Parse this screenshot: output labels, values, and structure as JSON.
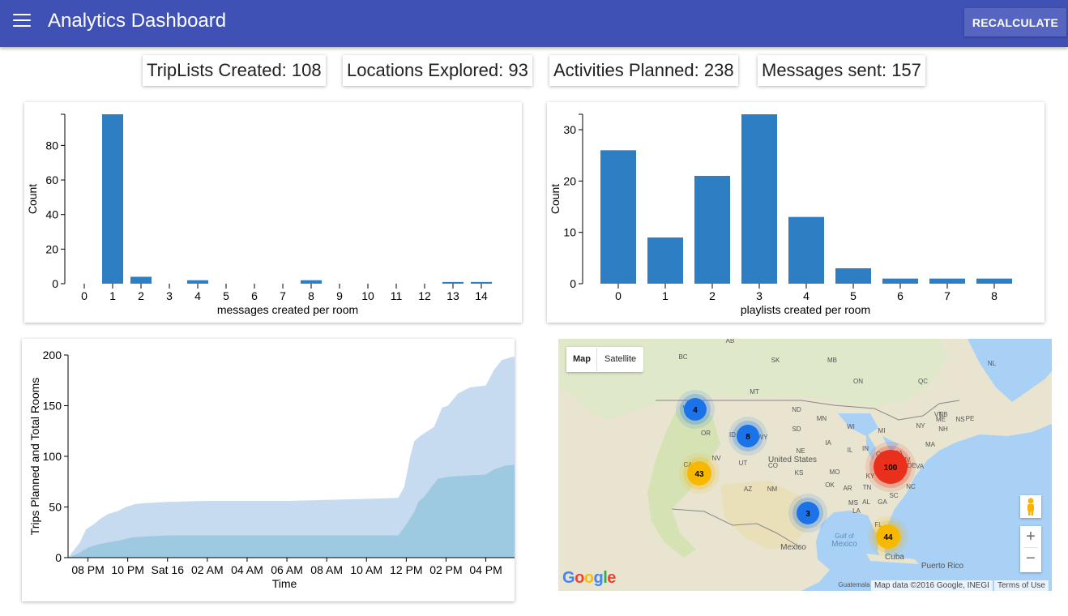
{
  "header": {
    "title": "Analytics Dashboard",
    "recalculate_label": "RECALCULATE",
    "menu_icon": "menu-icon"
  },
  "stats": [
    {
      "label": "TripLists Created: 108"
    },
    {
      "label": "Locations Explored: 93"
    },
    {
      "label": "Activities Planned: 238"
    },
    {
      "label": "Messages sent: 157"
    }
  ],
  "chart_data": [
    {
      "type": "bar",
      "categories": [
        "0",
        "1",
        "2",
        "3",
        "4",
        "5",
        "6",
        "7",
        "8",
        "9",
        "10",
        "11",
        "12",
        "13",
        "14"
      ],
      "values": [
        0,
        98,
        4,
        0,
        2,
        0,
        0,
        0,
        2,
        0,
        0,
        0,
        0,
        1,
        1
      ],
      "xlabel": "messages created per room",
      "ylabel": "Count",
      "ylim": [
        0,
        98
      ],
      "yticks": [
        0,
        20,
        40,
        60,
        80
      ],
      "color": "#2e7ec3"
    },
    {
      "type": "bar",
      "categories": [
        "0",
        "1",
        "2",
        "3",
        "4",
        "5",
        "6",
        "7",
        "8"
      ],
      "values": [
        26,
        9,
        21,
        33,
        13,
        3,
        1,
        1,
        1
      ],
      "xlabel": "playlists created per room",
      "ylabel": "Count",
      "ylim": [
        0,
        33
      ],
      "yticks": [
        0,
        10,
        20,
        30
      ],
      "color": "#2e7ec3"
    },
    {
      "type": "area",
      "xlabel": "Time",
      "ylabel": "Trips Planned and Total Rooms",
      "ylim": [
        0,
        200
      ],
      "yticks": [
        0,
        50,
        100,
        150,
        200
      ],
      "x_tick_labels": [
        "08 PM",
        "10 PM",
        "Sat 16",
        "02 AM",
        "04 AM",
        "06 AM",
        "08 AM",
        "10 AM",
        "12 PM",
        "02 PM",
        "04 PM"
      ],
      "x_hours": [
        0,
        2,
        4,
        6,
        8,
        10,
        12,
        14,
        16,
        18,
        20
      ],
      "series": [
        {
          "color": "#c6dbef",
          "points": [
            [
              -1.0,
              0
            ],
            [
              -0.4,
              15
            ],
            [
              -0.1,
              28
            ],
            [
              0.3,
              33
            ],
            [
              0.6,
              38
            ],
            [
              1.0,
              43
            ],
            [
              1.5,
              46
            ],
            [
              1.9,
              50
            ],
            [
              2.4,
              53
            ],
            [
              3.0,
              54
            ],
            [
              4.0,
              55
            ],
            [
              6.0,
              56
            ],
            [
              8.0,
              56
            ],
            [
              10.0,
              56
            ],
            [
              12.0,
              57
            ],
            [
              14.0,
              58
            ],
            [
              15.6,
              59
            ],
            [
              15.9,
              70
            ],
            [
              16.2,
              100
            ],
            [
              16.4,
              115
            ],
            [
              16.7,
              120
            ],
            [
              17.0,
              124
            ],
            [
              17.4,
              129
            ],
            [
              17.8,
              148
            ],
            [
              18.1,
              150
            ],
            [
              18.6,
              162
            ],
            [
              19.2,
              168
            ],
            [
              20.0,
              170
            ],
            [
              20.4,
              185
            ],
            [
              20.8,
              195
            ],
            [
              21.3,
              198
            ],
            [
              21.6,
              199
            ]
          ]
        },
        {
          "color": "#9ecae1",
          "points": [
            [
              -1.0,
              0
            ],
            [
              -0.4,
              5
            ],
            [
              0.0,
              10
            ],
            [
              0.5,
              13
            ],
            [
              1.0,
              15
            ],
            [
              1.6,
              17
            ],
            [
              2.2,
              20
            ],
            [
              3.0,
              21
            ],
            [
              4.0,
              22
            ],
            [
              6.0,
              22
            ],
            [
              8.0,
              22
            ],
            [
              10.0,
              22
            ],
            [
              12.0,
              22
            ],
            [
              14.0,
              22
            ],
            [
              15.6,
              22
            ],
            [
              15.9,
              30
            ],
            [
              16.4,
              45
            ],
            [
              16.6,
              55
            ],
            [
              16.9,
              60
            ],
            [
              17.2,
              68
            ],
            [
              17.6,
              78
            ],
            [
              18.2,
              80
            ],
            [
              19.0,
              81
            ],
            [
              20.0,
              82
            ],
            [
              20.4,
              87
            ],
            [
              21.0,
              91
            ],
            [
              21.6,
              92
            ]
          ]
        }
      ]
    }
  ],
  "map": {
    "map_label": "Map",
    "satellite_label": "Satellite",
    "google_logo": "Google",
    "attribution": "Map data ©2016 Google, INEGI",
    "terms": "Terms of Use",
    "pegman_icon": "pegman-icon",
    "zoom_in_label": "+",
    "zoom_out_label": "−",
    "place_labels": [
      {
        "text": "AB"
      },
      {
        "text": "BC"
      },
      {
        "text": "SK"
      },
      {
        "text": "MB"
      },
      {
        "text": "QC"
      },
      {
        "text": "NL"
      },
      {
        "text": "ON"
      },
      {
        "text": "WA"
      },
      {
        "text": "MT"
      },
      {
        "text": "ND"
      },
      {
        "text": "MN"
      },
      {
        "text": "ME"
      },
      {
        "text": "NB"
      },
      {
        "text": "NS"
      },
      {
        "text": "PE"
      },
      {
        "text": "OR"
      },
      {
        "text": "ID"
      },
      {
        "text": "WY"
      },
      {
        "text": "SD"
      },
      {
        "text": "WI"
      },
      {
        "text": "MI"
      },
      {
        "text": "NY"
      },
      {
        "text": "VT"
      },
      {
        "text": "NH"
      },
      {
        "text": "MA"
      },
      {
        "text": "NE"
      },
      {
        "text": "IA"
      },
      {
        "text": "IL"
      },
      {
        "text": "IN"
      },
      {
        "text": "OH"
      },
      {
        "text": "PA"
      },
      {
        "text": "NV"
      },
      {
        "text": "UT"
      },
      {
        "text": "CO"
      },
      {
        "text": "United States"
      },
      {
        "text": "KS"
      },
      {
        "text": "MO"
      },
      {
        "text": "KY"
      },
      {
        "text": "WV"
      },
      {
        "text": "VA"
      },
      {
        "text": "DE"
      },
      {
        "text": "NC"
      },
      {
        "text": "OK"
      },
      {
        "text": "AR"
      },
      {
        "text": "TN"
      },
      {
        "text": "SC"
      },
      {
        "text": "AZ"
      },
      {
        "text": "NM"
      },
      {
        "text": "MS"
      },
      {
        "text": "AL"
      },
      {
        "text": "GA"
      },
      {
        "text": "LA"
      },
      {
        "text": "FL"
      },
      {
        "text": "TX"
      },
      {
        "text": "Gulf of"
      },
      {
        "text": "Mexico"
      },
      {
        "text": "Mexico"
      },
      {
        "text": "Cuba"
      },
      {
        "text": "Puerto Rico"
      },
      {
        "text": "Guatemala"
      },
      {
        "text": "CA"
      }
    ],
    "clusters": [
      {
        "count": "4",
        "color": "#1a73e8"
      },
      {
        "count": "8",
        "color": "#1a73e8"
      },
      {
        "count": "43",
        "color": "#f9b800"
      },
      {
        "count": "100",
        "color": "#e8301c"
      },
      {
        "count": "3",
        "color": "#1a73e8"
      },
      {
        "count": "44",
        "color": "#f9b800"
      }
    ]
  }
}
